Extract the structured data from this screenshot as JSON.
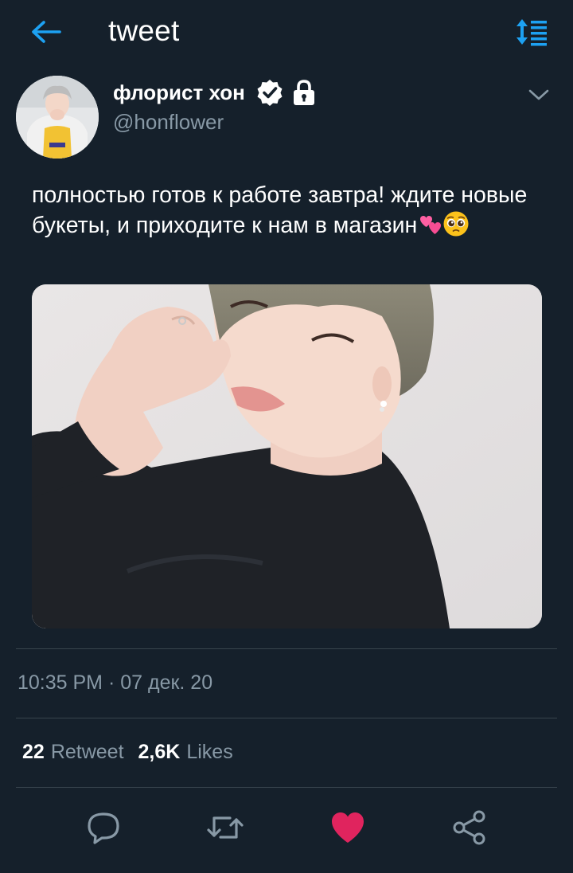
{
  "header": {
    "title": "tweet"
  },
  "author": {
    "name": "флорист хон",
    "handle": "@honflower"
  },
  "tweet": {
    "text": "полностью готов к работе завтра! ждите новые букеты, и приходите к нам в магазин",
    "emojis": [
      "two-hearts",
      "pleading-face"
    ],
    "timestamp": "10:35 PM · 07 дек. 20"
  },
  "stats": {
    "retweets_count": "22",
    "retweets_label": "Retweet",
    "likes_count": "2,6K",
    "likes_label": "Likes"
  },
  "icons": {
    "back": "arrow-left-icon",
    "sort": "sort-toggle-icon",
    "verified": "verified-badge-icon",
    "lock": "lock-icon",
    "caret": "chevron-down-icon",
    "reply": "reply-icon",
    "retweet": "retweet-icon",
    "like": "heart-icon",
    "share": "share-icon"
  },
  "colors": {
    "background": "#15202b",
    "accent": "#1da1f2",
    "like": "#e0245e",
    "muted": "#8899a6",
    "divider": "#38444d"
  },
  "state": {
    "liked": true
  }
}
